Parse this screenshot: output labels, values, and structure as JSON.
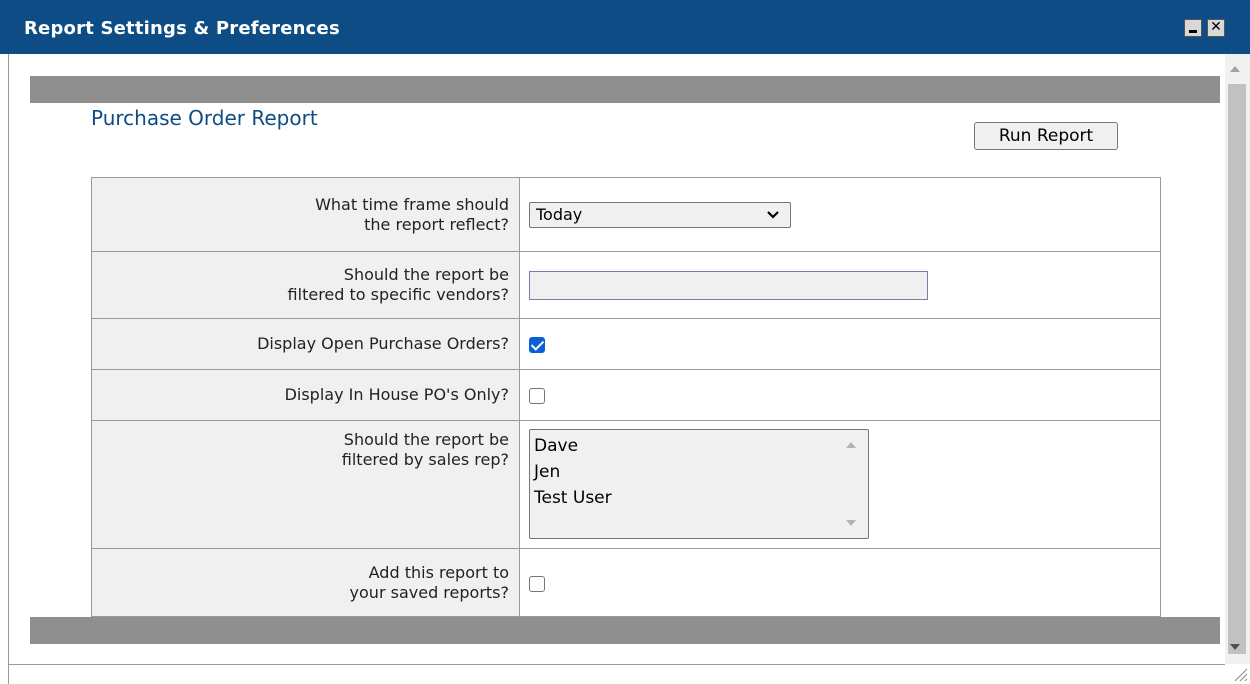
{
  "window": {
    "title": "Report Settings & Preferences",
    "minimize_symbol": "",
    "close_symbol": "✕"
  },
  "report": {
    "title": "Purchase Order Report",
    "run_button": "Run Report"
  },
  "fields": {
    "time_frame": {
      "label_line1": "What time frame should",
      "label_line2": "the report reflect?",
      "selected": "Today",
      "chevron": "⌄"
    },
    "vendors": {
      "label_line1": "Should the report be",
      "label_line2": "filtered to specific vendors?",
      "value": ""
    },
    "open_pos": {
      "label": "Display Open Purchase Orders?",
      "checked": true
    },
    "in_house": {
      "label": "Display In House PO's Only?",
      "checked": false
    },
    "sales_rep": {
      "label_line1": "Should the report be",
      "label_line2": "filtered by sales rep?",
      "options": [
        "Dave",
        "Jen",
        "Test User"
      ]
    },
    "save_report": {
      "label_line1": "Add this report to",
      "label_line2": "your saved reports?",
      "checked": false
    }
  },
  "colors": {
    "titlebar": "#0d4c84",
    "report_title": "#0d4c84",
    "panel_bar": "#8f8f8f",
    "checkbox_checked": "#0b5fd6"
  },
  "icons": {
    "minimize": "minimize-icon",
    "close": "close-icon",
    "dropdown": "chevron-down-icon",
    "scroll_up": "scroll-up-arrow-icon",
    "scroll_down": "scroll-down-arrow-icon",
    "resize": "resize-grip-icon",
    "checkmark": "checkmark-icon"
  }
}
